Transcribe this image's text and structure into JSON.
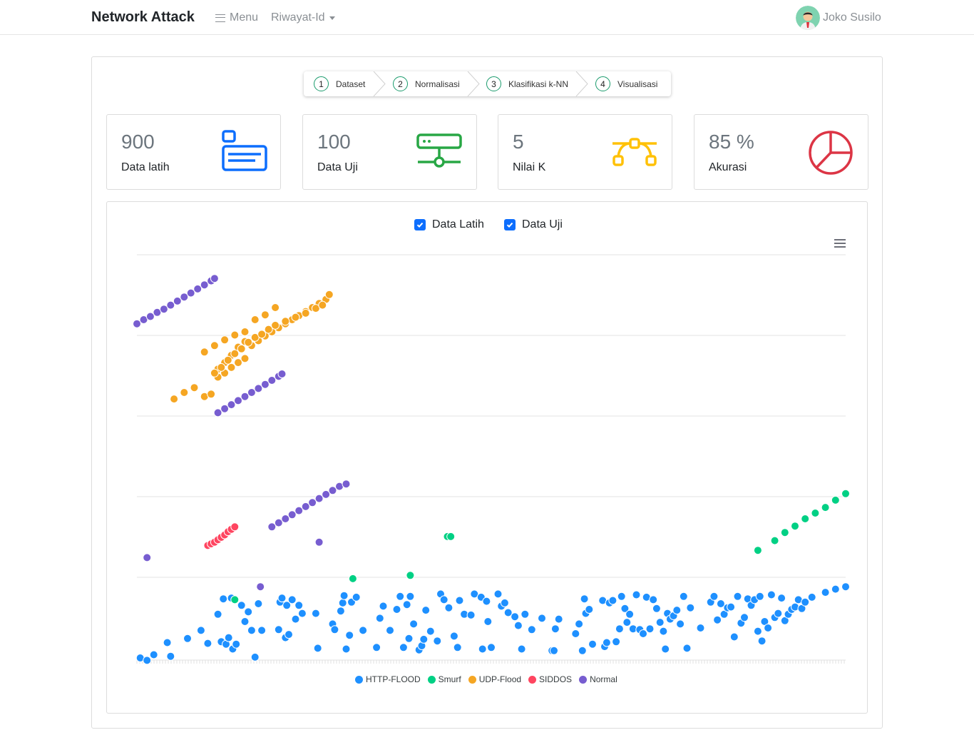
{
  "navbar": {
    "brand": "Network Attack",
    "menu_label": "Menu",
    "dropdown_label": "Riwayat-Id",
    "user_name": "Joko Susilo"
  },
  "stepper": {
    "steps": [
      {
        "num": "1",
        "label": "Dataset"
      },
      {
        "num": "2",
        "label": "Normalisasi"
      },
      {
        "num": "3",
        "label": "Klasifikasi k-NN"
      },
      {
        "num": "4",
        "label": "Visualisasi"
      }
    ]
  },
  "stats": [
    {
      "value": "900",
      "label": "Data latih",
      "icon": "card-icon",
      "color": "#0d6efd"
    },
    {
      "value": "100",
      "label": "Data Uji",
      "icon": "server-network-icon",
      "color": "#28a745"
    },
    {
      "value": "5",
      "label": "Nilai K",
      "icon": "bezier-curve-icon",
      "color": "#ffc107"
    },
    {
      "value": "85 %",
      "label": "Akurasi",
      "icon": "pie-chart-icon",
      "color": "#dc3545"
    }
  ],
  "filters": {
    "train_label": "Data Latih",
    "train_checked": true,
    "test_label": "Data Uji",
    "test_checked": true
  },
  "chart_data": {
    "type": "scatter",
    "title": "",
    "xlabel": "",
    "ylabel": "",
    "grid": true,
    "legend_position": "bottom",
    "series": [
      {
        "name": "HTTP-FLOOD",
        "color": "#1e90ff",
        "points": [
          [
            0.5,
            0.0
          ],
          [
            1.5,
            -0.3
          ],
          [
            2.5,
            0.4
          ],
          [
            4.5,
            1.9
          ],
          [
            5,
            0.2
          ],
          [
            7.5,
            2.4
          ],
          [
            9.5,
            3.4
          ],
          [
            10.5,
            1.8
          ],
          [
            12,
            5.4
          ],
          [
            12.5,
            2.0
          ],
          [
            12.8,
            7.3
          ],
          [
            13.2,
            1.7
          ],
          [
            13.6,
            2.5
          ],
          [
            14,
            7.4
          ],
          [
            14.2,
            1.1
          ],
          [
            14.7,
            1.7
          ],
          [
            15.5,
            6.5
          ],
          [
            16,
            4.5
          ],
          [
            16.5,
            5.7
          ],
          [
            17,
            3.4
          ],
          [
            17.5,
            0.1
          ],
          [
            18,
            6.7
          ],
          [
            18.5,
            3.4
          ],
          [
            21,
            3.5
          ],
          [
            21.2,
            6.9
          ],
          [
            21.5,
            7.4
          ],
          [
            22,
            2.5
          ],
          [
            22.2,
            6.5
          ],
          [
            22.5,
            2.9
          ],
          [
            23,
            7.2
          ],
          [
            23.5,
            4.8
          ],
          [
            24,
            6.5
          ],
          [
            24.5,
            5.5
          ],
          [
            26.5,
            5.5
          ],
          [
            26.8,
            1.2
          ],
          [
            29,
            4.2
          ],
          [
            29.3,
            3.5
          ],
          [
            30.2,
            5.8
          ],
          [
            30.5,
            6.8
          ],
          [
            30.7,
            7.7
          ],
          [
            31,
            1.1
          ],
          [
            31.5,
            2.8
          ],
          [
            31.8,
            6.9
          ],
          [
            32.5,
            7.5
          ],
          [
            33.5,
            3.4
          ],
          [
            35.5,
            1.3
          ],
          [
            36,
            4.9
          ],
          [
            36.5,
            6.4
          ],
          [
            37.5,
            3.4
          ],
          [
            38.5,
            6.0
          ],
          [
            39,
            7.6
          ],
          [
            39.5,
            1.3
          ],
          [
            40,
            6.6
          ],
          [
            40.3,
            2.4
          ],
          [
            40.5,
            7.6
          ],
          [
            41,
            4.2
          ],
          [
            41.8,
            1.0
          ],
          [
            42.2,
            1.5
          ],
          [
            42.5,
            2.3
          ],
          [
            42.8,
            5.9
          ],
          [
            43.5,
            3.3
          ],
          [
            44.5,
            2.1
          ],
          [
            45,
            7.9
          ],
          [
            45.5,
            7.2
          ],
          [
            46.2,
            6.2
          ],
          [
            47,
            2.7
          ],
          [
            47.5,
            1.3
          ],
          [
            47.8,
            7.1
          ],
          [
            48.5,
            5.4
          ],
          [
            49.5,
            5.3
          ],
          [
            50,
            7.9
          ],
          [
            51,
            7.5
          ],
          [
            51.2,
            1.1
          ],
          [
            51.8,
            7.0
          ],
          [
            52,
            4.5
          ],
          [
            52.5,
            1.3
          ],
          [
            53.5,
            7.9
          ],
          [
            54,
            6.4
          ],
          [
            54.5,
            6.8
          ],
          [
            55,
            5.6
          ],
          [
            56,
            5.1
          ],
          [
            56.5,
            4.0
          ],
          [
            57,
            1.1
          ],
          [
            57.5,
            5.4
          ],
          [
            58.5,
            3.5
          ],
          [
            60,
            4.9
          ],
          [
            61.5,
            0.9
          ],
          [
            61.8,
            0.9
          ],
          [
            62,
            3.6
          ],
          [
            62.5,
            4.8
          ],
          [
            65,
            3.0
          ],
          [
            65.5,
            4.2
          ],
          [
            66,
            0.9
          ],
          [
            66.3,
            7.3
          ],
          [
            66.5,
            5.5
          ],
          [
            67,
            6.0
          ],
          [
            67.5,
            1.7
          ],
          [
            69,
            7.1
          ],
          [
            69.3,
            1.4
          ],
          [
            69.6,
            1.9
          ],
          [
            70,
            6.8
          ],
          [
            70.5,
            7.1
          ],
          [
            71,
            2.0
          ],
          [
            71.5,
            3.6
          ],
          [
            71.8,
            7.6
          ],
          [
            72.3,
            6.1
          ],
          [
            72.6,
            4.4
          ],
          [
            73,
            5.4
          ],
          [
            73.5,
            3.6
          ],
          [
            74,
            7.8
          ],
          [
            74.5,
            3.5
          ],
          [
            75,
            3.0
          ],
          [
            75.5,
            7.5
          ],
          [
            76,
            3.6
          ],
          [
            76.5,
            7.2
          ],
          [
            77,
            6.1
          ],
          [
            77.5,
            4.4
          ],
          [
            78,
            3.3
          ],
          [
            78.3,
            1.1
          ],
          [
            78.6,
            5.5
          ],
          [
            79,
            4.8
          ],
          [
            79.5,
            5.2
          ],
          [
            80,
            5.9
          ],
          [
            80.5,
            4.2
          ],
          [
            81,
            7.6
          ],
          [
            81.5,
            1.2
          ],
          [
            82,
            6.2
          ],
          [
            83.5,
            3.7
          ],
          [
            85,
            6.9
          ],
          [
            85.5,
            7.6
          ],
          [
            86,
            4.7
          ],
          [
            86.5,
            6.7
          ],
          [
            87,
            5.4
          ],
          [
            87.5,
            6.2
          ],
          [
            88,
            6.3
          ],
          [
            88.5,
            2.6
          ],
          [
            89,
            7.6
          ],
          [
            89.5,
            4.3
          ],
          [
            90,
            5.0
          ],
          [
            90.5,
            7.3
          ],
          [
            91,
            6.5
          ],
          [
            91.5,
            7.2
          ],
          [
            92,
            3.3
          ],
          [
            92.3,
            7.6
          ],
          [
            92.6,
            2.1
          ],
          [
            93,
            4.5
          ],
          [
            93.5,
            3.7
          ],
          [
            94,
            7.8
          ],
          [
            94.5,
            5.0
          ],
          [
            95,
            5.5
          ],
          [
            95.5,
            7.4
          ],
          [
            96,
            4.6
          ],
          [
            96.5,
            5.4
          ],
          [
            97,
            6.0
          ],
          [
            97.5,
            6.3
          ],
          [
            98,
            7.2
          ],
          [
            98.5,
            6.1
          ],
          [
            99,
            6.9
          ],
          [
            100,
            7.5
          ],
          [
            102,
            8.1
          ],
          [
            103.5,
            8.5
          ],
          [
            105,
            8.8
          ]
        ]
      },
      {
        "name": "Smurf",
        "color": "#00d084",
        "points": [
          [
            14.5,
            7.2
          ],
          [
            32,
            9.8
          ],
          [
            40.5,
            10.2
          ],
          [
            46,
            15.0
          ],
          [
            46.5,
            15.0
          ],
          [
            92,
            13.3
          ],
          [
            94.5,
            14.5
          ],
          [
            96,
            15.5
          ],
          [
            97.5,
            16.3
          ],
          [
            99,
            17.2
          ],
          [
            100.5,
            17.9
          ],
          [
            102,
            18.6
          ],
          [
            103.5,
            19.5
          ],
          [
            105,
            20.3
          ]
        ]
      },
      {
        "name": "UDP-Flood",
        "color": "#f5a623",
        "points": [
          [
            5.5,
            32.0
          ],
          [
            7,
            32.8
          ],
          [
            8.5,
            33.4
          ],
          [
            10,
            32.3
          ],
          [
            11,
            32.6
          ],
          [
            12,
            34.7
          ],
          [
            13,
            35.2
          ],
          [
            14,
            35.9
          ],
          [
            15,
            36.5
          ],
          [
            16,
            37.0
          ],
          [
            17,
            38.6
          ],
          [
            18,
            39.2
          ],
          [
            19,
            39.8
          ],
          [
            20,
            40.3
          ],
          [
            21,
            40.8
          ],
          [
            22,
            41.3
          ],
          [
            23,
            41.8
          ],
          [
            24,
            42.3
          ],
          [
            25,
            42.8
          ],
          [
            26,
            43.3
          ],
          [
            27,
            43.8
          ],
          [
            28,
            44.3
          ],
          [
            28.5,
            44.9
          ],
          [
            12,
            35.7
          ],
          [
            13,
            36.5
          ],
          [
            14,
            37.4
          ],
          [
            15,
            38.4
          ],
          [
            16,
            39.1
          ],
          [
            17.5,
            39.6
          ],
          [
            18.5,
            40.0
          ],
          [
            19.5,
            40.6
          ],
          [
            20.5,
            41.1
          ],
          [
            22,
            41.6
          ],
          [
            23.5,
            42.1
          ],
          [
            25,
            42.6
          ],
          [
            26.5,
            43.2
          ],
          [
            27.5,
            43.6
          ],
          [
            11.5,
            35.2
          ],
          [
            12.5,
            35.9
          ],
          [
            13.5,
            36.8
          ],
          [
            14.5,
            37.6
          ],
          [
            15.5,
            38.2
          ],
          [
            16.5,
            39.0
          ],
          [
            10,
            37.8
          ],
          [
            11.5,
            38.6
          ],
          [
            13,
            39.3
          ],
          [
            14.5,
            39.9
          ],
          [
            16,
            40.3
          ],
          [
            17.5,
            41.8
          ],
          [
            19,
            42.4
          ],
          [
            20.5,
            43.3
          ]
        ]
      },
      {
        "name": "SIDDOS",
        "color": "#ff4560",
        "points": [
          [
            10.5,
            13.9
          ],
          [
            11,
            14.1
          ],
          [
            11.5,
            14.3
          ],
          [
            12,
            14.6
          ],
          [
            12.5,
            14.9
          ],
          [
            13,
            15.2
          ],
          [
            13.5,
            15.6
          ],
          [
            14,
            15.9
          ],
          [
            14.5,
            16.2
          ]
        ]
      },
      {
        "name": "Normal",
        "color": "#775dd0",
        "points": [
          [
            0,
            41.3
          ],
          [
            1,
            41.8
          ],
          [
            2,
            42.2
          ],
          [
            3,
            42.7
          ],
          [
            4,
            43.1
          ],
          [
            5,
            43.6
          ],
          [
            6,
            44.1
          ],
          [
            7,
            44.6
          ],
          [
            8,
            45.1
          ],
          [
            9,
            45.6
          ],
          [
            10,
            46.1
          ],
          [
            11,
            46.6
          ],
          [
            11.5,
            46.9
          ],
          [
            1.5,
            12.4
          ],
          [
            18.3,
            8.8
          ],
          [
            27,
            14.3
          ],
          [
            12,
            30.3
          ],
          [
            13,
            30.8
          ],
          [
            14,
            31.3
          ],
          [
            15,
            31.8
          ],
          [
            16,
            32.3
          ],
          [
            17,
            32.8
          ],
          [
            18,
            33.3
          ],
          [
            19,
            33.8
          ],
          [
            20,
            34.3
          ],
          [
            21,
            34.8
          ],
          [
            21.5,
            35.1
          ],
          [
            20,
            16.2
          ],
          [
            21,
            16.7
          ],
          [
            22,
            17.2
          ],
          [
            23,
            17.7
          ],
          [
            24,
            18.2
          ],
          [
            25,
            18.7
          ],
          [
            26,
            19.2
          ],
          [
            27,
            19.7
          ],
          [
            28,
            20.2
          ],
          [
            29,
            20.7
          ],
          [
            30,
            21.2
          ],
          [
            31,
            21.5
          ]
        ]
      }
    ]
  },
  "toolbar": {
    "menu_icon": "hamburger-menu-icon"
  }
}
